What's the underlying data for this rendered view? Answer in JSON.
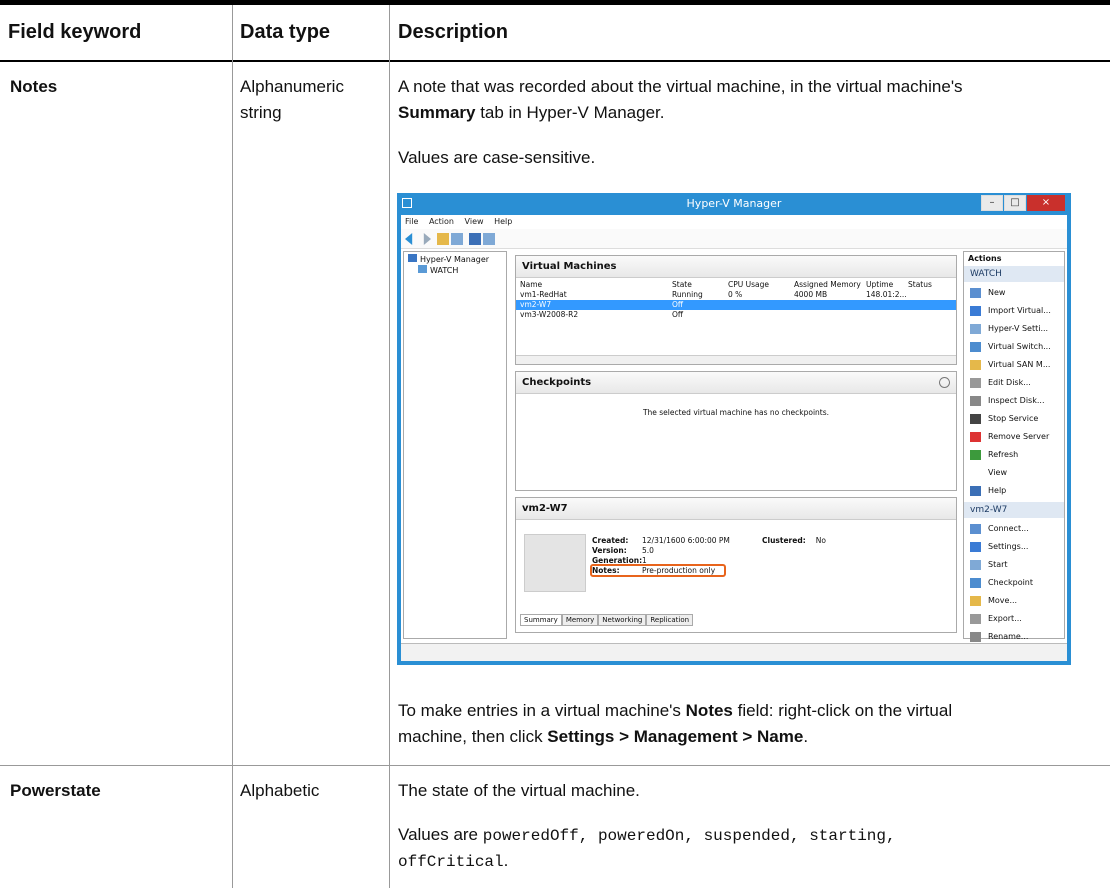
{
  "table": {
    "headers": [
      "Field keyword",
      "Data type",
      "Description"
    ],
    "rows": [
      {
        "keyword": "Notes",
        "type_line1": "Alphanumeric",
        "type_line2": "string",
        "desc1_a": "A note that was recorded about the virtual machine, in the virtual machine's",
        "desc1_b_bold": "Summary",
        "desc1_b_rest": " tab in Hyper-V Manager.",
        "desc2": "Values are case-sensitive.",
        "desc3_a": "To make entries in a virtual machine's ",
        "desc3_b_bold": "Notes",
        "desc3_c": " field: right-click on the virtual",
        "desc3_d": "machine, then click ",
        "desc3_e_bold": "Settings > Management > Name",
        "desc3_f": "."
      },
      {
        "keyword": "Powerstate",
        "type_line1": "Alphabetic",
        "desc1": "The state of the virtual machine.",
        "desc2_a": "Values are ",
        "desc2_code1": "poweredOff, poweredOn, suspended, starting,",
        "desc2_code2": "offCritical",
        "desc2_end": "."
      }
    ]
  },
  "screenshot": {
    "title": "Hyper-V Manager",
    "menu": [
      "File",
      "Action",
      "View",
      "Help"
    ],
    "tree": [
      "Hyper-V Manager",
      "WATCH"
    ],
    "vm_panel_title": "Virtual Machines",
    "vm_columns": [
      "Name",
      "State",
      "CPU Usage",
      "Assigned Memory",
      "Uptime",
      "Status"
    ],
    "vms": [
      {
        "name": "vm1-RedHat",
        "state": "Running",
        "cpu": "0 %",
        "mem": "4000 MB",
        "uptime": "148.01:2..."
      },
      {
        "name": "vm2-W7",
        "state": "Off",
        "cpu": "",
        "mem": "",
        "uptime": ""
      },
      {
        "name": "vm3-W2008-R2",
        "state": "Off",
        "cpu": "",
        "mem": "",
        "uptime": ""
      }
    ],
    "checkpoints_title": "Checkpoints",
    "checkpoints_empty": "The selected virtual machine has no checkpoints.",
    "detail_title": "vm2-W7",
    "detail": {
      "created_label": "Created:",
      "created": "12/31/1600 6:00:00 PM",
      "clustered_label": "Clustered:",
      "clustered": "No",
      "version_label": "Version:",
      "version": "5.0",
      "generation_label": "Generation:",
      "generation": "1",
      "notes_label": "Notes:",
      "notes": "Pre-production only"
    },
    "detail_tabs": [
      "Summary",
      "Memory",
      "Networking",
      "Replication"
    ],
    "actions_title": "Actions",
    "actions_group1": "WATCH",
    "actions1": [
      "New",
      "Import Virtual...",
      "Hyper-V Setti...",
      "Virtual Switch...",
      "Virtual SAN M...",
      "Edit Disk...",
      "Inspect Disk...",
      "Stop Service",
      "Remove Server",
      "Refresh",
      "View",
      "Help"
    ],
    "actions_group2": "vm2-W7",
    "actions2": [
      "Connect...",
      "Settings...",
      "Start",
      "Checkpoint",
      "Move...",
      "Export...",
      "Rename..."
    ],
    "colors": {
      "titlebar": "#2a8fd4",
      "selection": "#3399ff",
      "highlight": "#e8641c",
      "close": "#c9302c"
    }
  }
}
